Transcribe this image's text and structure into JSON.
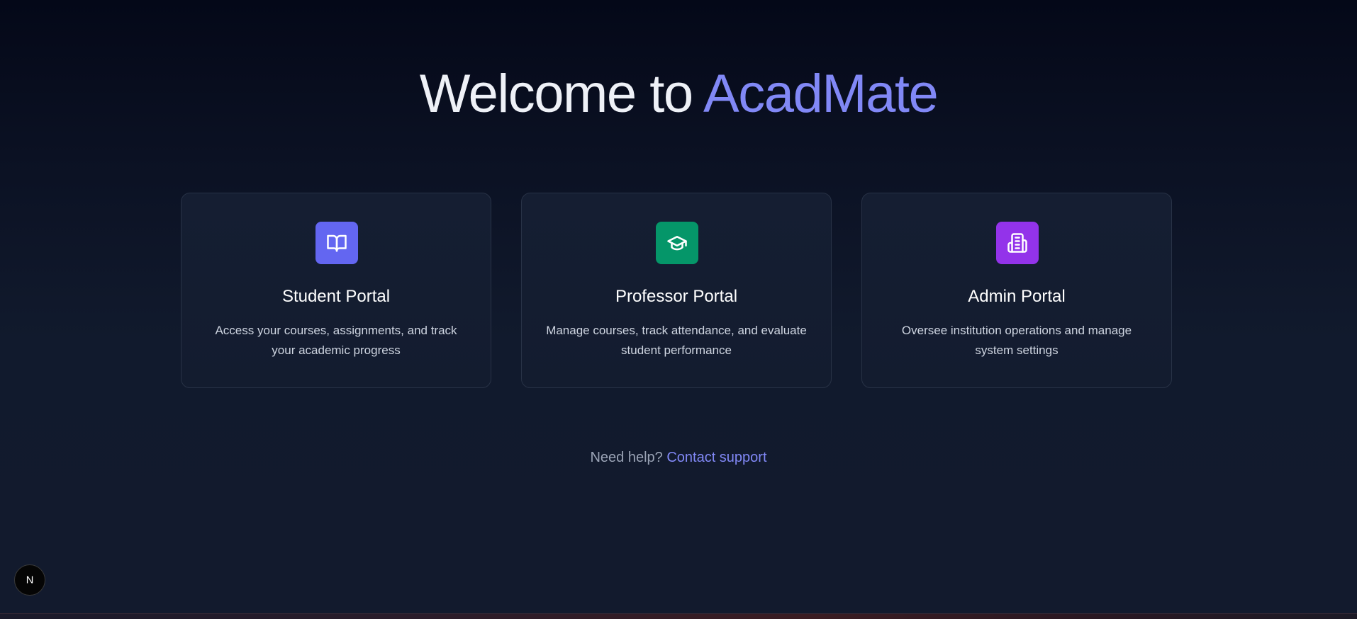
{
  "header": {
    "title_prefix": "Welcome to ",
    "title_brand": "AcadMate"
  },
  "portals": [
    {
      "title": "Student Portal",
      "description": "Access your courses, assignments, and track your academic progress",
      "icon": "book-open-icon",
      "color": "#6366f1"
    },
    {
      "title": "Professor Portal",
      "description": "Manage courses, track attendance, and evaluate student performance",
      "icon": "graduation-cap-icon",
      "color": "#059669"
    },
    {
      "title": "Admin Portal",
      "description": "Oversee institution operations and manage system settings",
      "icon": "building-icon",
      "color": "#9333ea"
    }
  ],
  "help": {
    "prompt": "Need help?",
    "link_label": "Contact support"
  },
  "dev_badge": {
    "label": "N"
  },
  "colors": {
    "accent": "#8188f6",
    "background": "#0b1123",
    "card_border": "#283246"
  }
}
